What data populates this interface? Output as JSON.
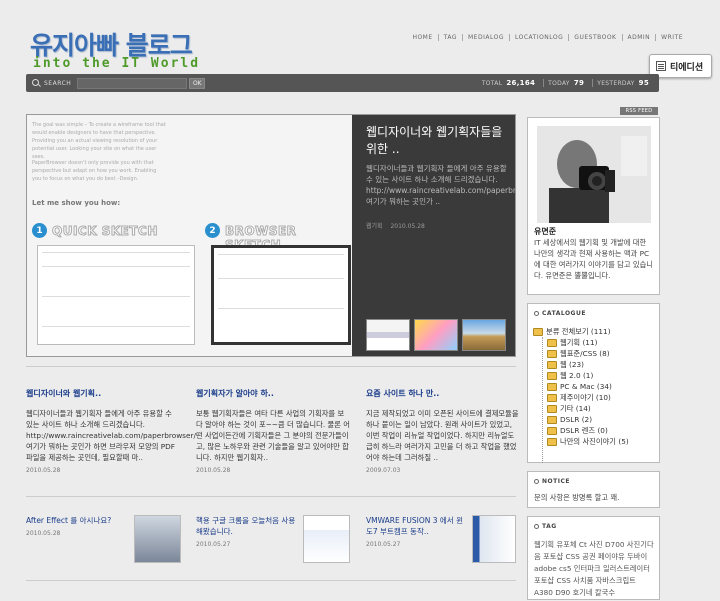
{
  "header": {
    "title": "유지아빠 블로그",
    "subtitle": "into the IT World",
    "nav": [
      "HOME",
      "TAG",
      "MEDIALOG",
      "LOCATIONLOG",
      "GUESTBOOK",
      "ADMIN",
      "WRITE"
    ],
    "edition_button": "티에디션"
  },
  "search": {
    "label": "SEARCH",
    "ok": "OK",
    "total_label": "TOTAL",
    "total": "26,164",
    "today_label": "TODAY",
    "today": "79",
    "yesterday_label": "YESTERDAY",
    "yesterday": "95"
  },
  "rss": "RSS FEED",
  "feature": {
    "image_text": {
      "para1": "The goal was simple – To create a wireframe tool that would enable designers to have that perspective. Providing you an actual viewing resolution of your potential user. Looking your site on what the user sees.",
      "para2": "PaperBrowser doesn't only provide you with that perspective but adapt on how you work. Enabling you to focus on what you do best –Design.",
      "show": "Let me show you how:",
      "step1_num": "1",
      "step1": "QUICK SKETCH",
      "step2_num": "2",
      "step2": "BROWSER SKETCH"
    },
    "title": "웹디자이너와 웹기획자들을 위한 ..",
    "text": "웹디자이너들과 웹기획자 들에게 아주 유용할 수 있는 사이트 하나 소개해 드리겠습니다. http://www.raincreativelab.com/paperbrowser/ 여기가 뭐하는 곳인가 ..",
    "category": "웹기획",
    "date": "2010.05.28"
  },
  "posts": [
    {
      "title": "웹디자이너와 웹기획..",
      "body": "웹디자이너들과 웹기획자 들에게 아주 유용할 수 있는 사이트 하나 소개해 드리겠습니다. http://www.raincreativelab.com/paperbrowser/ 여기가 뭐하는 곳인가 하면 브라우저 모양의 PDF 파일을 제공하는 곳인데, 필요할때 마..",
      "date": "2010.05.28"
    },
    {
      "title": "웹기획자가 알아야 하..",
      "body": "보통 웹기획자들은 여타 다른 사업의 기획자를 보다 알아야 하는 것이 포~~큼 더 많습니다. 물론 어떤 사업이든간에 기획자들은 그 분야의 전문가들이고, 많은 노하우와 관련 기술들을 알고 있어야만 합니다. 하지만 웹기획자..",
      "date": "2010.05.28"
    },
    {
      "title": "요즘 사이트 하나 만..",
      "body": "지금 제작되었고 이미 오픈된 사이트에 결제모듈을 하나 붙이는 일이 남았다. 원래 사이트가 있었고, 이번 작업이 리뉴얼 작업이었다. 하지만 리뉴얼도 급히 하느라 여러가지 고민을 더 하고 작업을 했었어야 하는데 그러하질 ..",
      "date": "2009.07.03"
    }
  ],
  "mini_posts": [
    {
      "title": "After Effect 를 아시나요?",
      "date": "2010.05.28"
    },
    {
      "title": "핵용 구글 크롬을 오늘처음 사용해봤습니다.",
      "date": "2010.05.27"
    },
    {
      "title": "VMWARE FUSION 3 에서 윈도7 부트캠프 동작..",
      "date": "2010.05.27"
    }
  ],
  "profile": {
    "name": "유면준",
    "desc": "IT 세상에서의 웹기획 및 개발에 대한 나만의 생각과 현재 사용하는 맥과 PC에 대한 여러가지 이야기를 담고 있습니다. 유면준은 뿔뿔입니다."
  },
  "catalogue": {
    "title": "CATALOGUE",
    "root": "분류 전체보기 (111)",
    "items": [
      "웹기획 (11)",
      "웹표준/CSS (8)",
      "웹 (23)",
      "웹 2.0 (1)",
      "PC & Mac (34)",
      "제주이야기 (10)",
      "기타 (14)",
      "DSLR (2)",
      "DSLR 렌즈 (0)",
      "나만의 사진이야기 (5)"
    ]
  },
  "notice": {
    "title": "NOTICE",
    "body": "문의 사항은 방명록 할고 꽤."
  },
  "tag": {
    "title": "TAG",
    "body": "웹기획 유포체 Ct 사진 D700 사진기다음 포토샵 CSS 공권 페이야유 두바이 adobe cs5 인터파크 일러스트레이터 포토샵 CSS 사치품 자바스크립트 A380 D90 호기네 칼국수"
  },
  "colors": {
    "title_blue": "#3a6fb6",
    "subtitle_green": "#4f9b2a",
    "link_blue": "#1a3c8a",
    "bar_dark": "#555555",
    "feature_dark": "#3a3a3a"
  }
}
